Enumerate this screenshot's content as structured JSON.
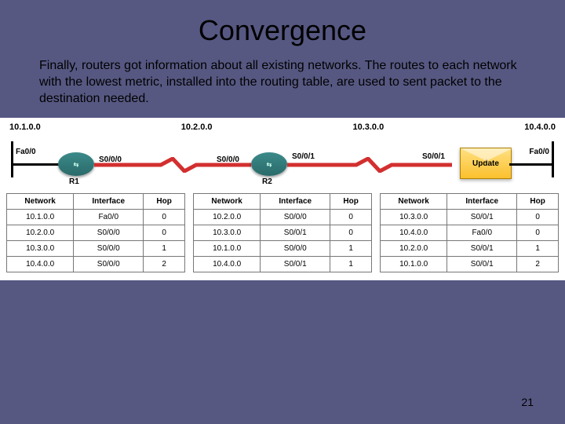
{
  "title": "Convergence",
  "body": "Finally, routers got information about all existing networks. The routes to each network with the lowest metric, installed into the routing table, are used to sent packet to the destination needed.",
  "page_number": "21",
  "networks": {
    "n1": "10.1.0.0",
    "n2": "10.2.0.0",
    "n3": "10.3.0.0",
    "n4": "10.4.0.0"
  },
  "interfaces": {
    "fa00_l": "Fa0/0",
    "fa00_r": "Fa0/0",
    "s000_r1": "S0/0/0",
    "s000_r2": "S0/0/0",
    "s001_r2": "S0/0/1",
    "s001_r3": "S0/0/1"
  },
  "routers": {
    "r1": "R1",
    "r2": "R2",
    "update": "Update"
  },
  "table_headers": {
    "network": "Network",
    "interface": "Interface",
    "hop": "Hop"
  },
  "tables": {
    "t1": [
      {
        "n": "10.1.0.0",
        "i": "Fa0/0",
        "h": "0"
      },
      {
        "n": "10.2.0.0",
        "i": "S0/0/0",
        "h": "0"
      },
      {
        "n": "10.3.0.0",
        "i": "S0/0/0",
        "h": "1"
      },
      {
        "n": "10.4.0.0",
        "i": "S0/0/0",
        "h": "2"
      }
    ],
    "t2": [
      {
        "n": "10.2.0.0",
        "i": "S0/0/0",
        "h": "0"
      },
      {
        "n": "10.3.0.0",
        "i": "S0/0/1",
        "h": "0"
      },
      {
        "n": "10.1.0.0",
        "i": "S0/0/0",
        "h": "1"
      },
      {
        "n": "10.4.0.0",
        "i": "S0/0/1",
        "h": "1"
      }
    ],
    "t3": [
      {
        "n": "10.3.0.0",
        "i": "S0/0/1",
        "h": "0"
      },
      {
        "n": "10.4.0.0",
        "i": "Fa0/0",
        "h": "0"
      },
      {
        "n": "10.2.0.0",
        "i": "S0/0/1",
        "h": "1"
      },
      {
        "n": "10.1.0.0",
        "i": "S0/0/1",
        "h": "2"
      }
    ]
  }
}
